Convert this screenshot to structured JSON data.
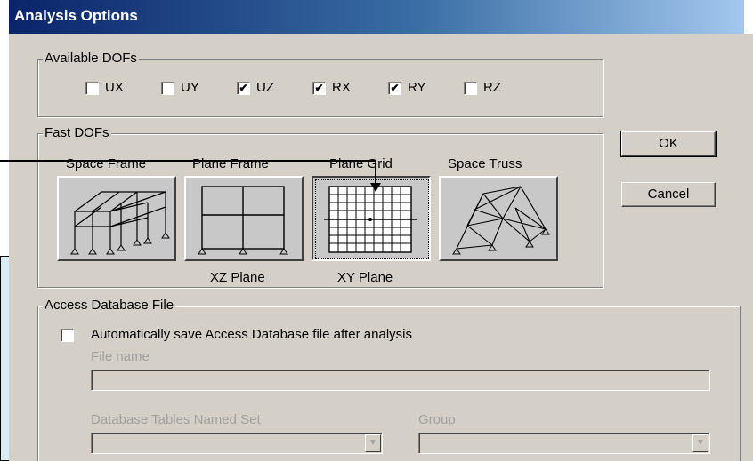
{
  "dialog": {
    "title": "Analysis Options",
    "available_dofs": {
      "legend": "Available DOFs",
      "items": [
        {
          "label": "UX",
          "checked": false
        },
        {
          "label": "UY",
          "checked": false
        },
        {
          "label": "UZ",
          "checked": true
        },
        {
          "label": "RX",
          "checked": true
        },
        {
          "label": "RY",
          "checked": true
        },
        {
          "label": "RZ",
          "checked": false
        }
      ]
    },
    "fast_dofs": {
      "legend": "Fast DOFs",
      "options": [
        {
          "label": "Space Frame",
          "plane": "",
          "selected": false
        },
        {
          "label": "Plane Frame",
          "plane": "XZ Plane",
          "selected": false
        },
        {
          "label": "Plane Grid",
          "plane": "XY Plane",
          "selected": true
        },
        {
          "label": "Space Truss",
          "plane": "",
          "selected": false
        }
      ]
    },
    "buttons": {
      "ok": "OK",
      "cancel": "Cancel"
    },
    "access_db": {
      "legend": "Access Database File",
      "auto_save_label": "Automatically save Access Database file after analysis",
      "auto_save_checked": false,
      "file_name_label": "File name",
      "file_name_value": "",
      "tables_label": "Database Tables Named Set",
      "tables_value": "",
      "group_label": "Group",
      "group_value": ""
    }
  },
  "colors": {
    "title_start": "#0a246a",
    "title_end": "#a6caf0",
    "dialog_bg": "#d4d0c8",
    "callout_bg": "#d8ecf4"
  }
}
